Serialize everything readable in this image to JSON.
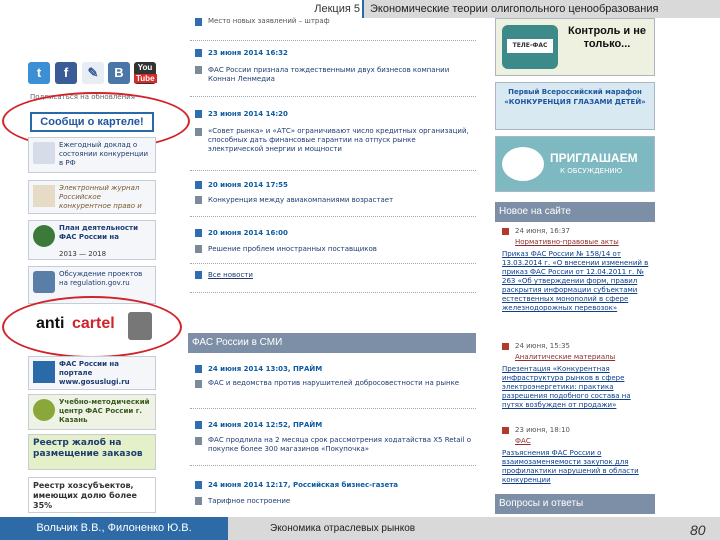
{
  "header": {
    "lecture": "Лекция 5",
    "topic": "Экономические теории олигопольного ценообразования"
  },
  "left": {
    "subscribe": "Подписаться на обновления",
    "report_cartel": "Сообщи о картеле!",
    "annual_report": "Ежегодный доклад о состоянии конкуренции в РФ",
    "journal": "Электронный журнал Российское конкурентное право и экономика",
    "plan": "План деятельности ФАС России на",
    "plan_years": "2013 — 2018",
    "discussion": "Обсуждение проектов на regulation.gov.ru",
    "anticartel_a": "anti",
    "anticartel_b": "cartel",
    "gosuslugi": "ФАС России на портале www.gosuslugi.ru",
    "method_center": "Учебно-методический центр ФАС России г. Казань",
    "complaints": "Реестр жалоб на размещение заказов",
    "holding": "Реестр хозсубъектов, имеющих долю более 35%"
  },
  "news": {
    "top": "Место новых заявлений – штраф",
    "items": [
      {
        "date": "23 июня 2014 16:32",
        "text": "ФАС России признала тождественными двух бизнесов компании Коннан Ленмедиа"
      },
      {
        "date": "23 июня 2014 14:20",
        "text": "«Совет рынка» и «АТС» ограничивают число кредитных организаций, способных дать финансовые гарантии на отпуск рынке электрической энергии и мощности"
      },
      {
        "date": "20 июня 2014 17:55",
        "text": "Конкуренция между авиакомпаниями возрастает"
      },
      {
        "date": "20 июня 2014 16:00",
        "text": "Решение проблем иностранных поставщиков"
      }
    ],
    "all_news": "Все новости"
  },
  "smi": {
    "title": "ФАС России в СМИ",
    "items": [
      {
        "date": "24 июня 2014 13:03, ПРАЙМ",
        "text": "ФАС и ведомства против нарушителей добросовестности на рынке"
      },
      {
        "date": "24 июня 2014 12:52, ПРАЙМ",
        "text": "ФАС продлила на 2 месяца срок рассмотрения ходатайства X5 Retail о покупке более 300 магазинов «Покупочка»"
      },
      {
        "date": "24 июня 2014 12:17, Российская бизнес-газета",
        "text": "Тарифное построение"
      }
    ]
  },
  "right": {
    "control_title": "Контроль и не только...",
    "tv_label": "ТЕЛЕ-ФАС",
    "marathon": "Первый Всероссийский марафон «КОНКУРЕНЦИЯ ГЛАЗАМИ ДЕТЕЙ»",
    "invite_title": "ПРИГЛАШАЕМ",
    "invite_sub": "К ОБСУЖДЕНИЮ",
    "new_title": "Новое на сайте",
    "new_items": [
      {
        "date": "24 июня, 16:37",
        "tag": "Нормативно-правовые акты",
        "text": "Приказ ФАС России № 158/14 от 13.03.2014 г. «О внесении изменений в приказ ФАС России от 12.04.2011 г. № 263 «Об утверждении форм, правил раскрытия информации субъектами естественных монополий в сфере железнодорожных перевозок»"
      },
      {
        "date": "24 июня, 15:35",
        "tag": "Аналитические материалы",
        "text": "Презентация «Конкурентная инфраструктура рынков в сфере электроэнергетики: практика разрешения подобного состава на путях возбужден от продажи»"
      },
      {
        "date": "23 июня, 18:10",
        "tag": "ФАС",
        "text": "Разъяснения ФАС России о взаимозаменяемости закупок для профилактики нарушений в области конкуренции"
      }
    ],
    "qa_title": "Вопросы и ответы"
  },
  "footer": {
    "author": "Вольчик В.В., Филоненко Ю.В.",
    "course": "Экономика отраслевых рынков",
    "page": "80"
  },
  "colors": {
    "accent": "#2e6aa5",
    "highlight_ring": "#d1242a",
    "section_bar": "#7d8fa6"
  }
}
